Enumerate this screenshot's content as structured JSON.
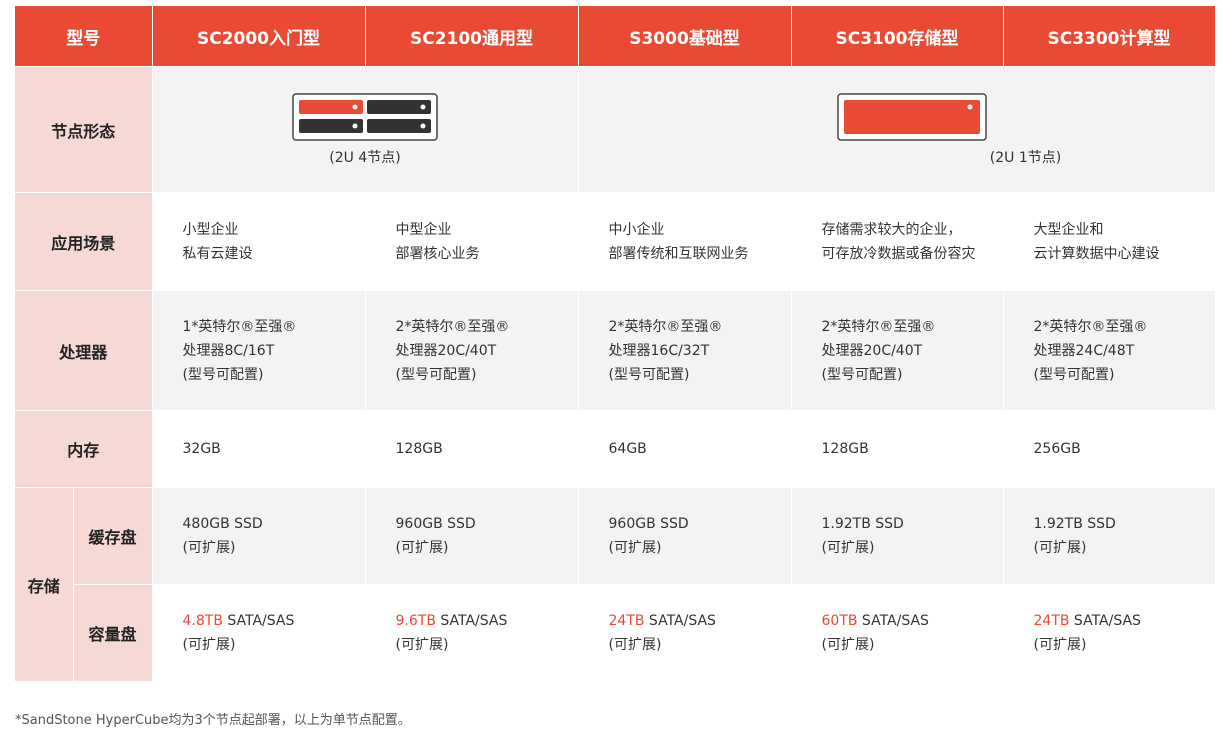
{
  "header": {
    "col0": "型号",
    "models": [
      "SC2000入门型",
      "SC2100通用型",
      "S3000基础型",
      "SC3100存储型",
      "SC3300计算型"
    ]
  },
  "rows": {
    "form": {
      "label": "节点形态",
      "left_caption": "(2U 4节点)",
      "right_caption": "(2U 1节点)",
      "left_icon": "server-2u-4node-icon",
      "right_icon": "server-2u-1node-icon"
    },
    "scenario": {
      "label": "应用场景",
      "values": [
        [
          "小型企业",
          "私有云建设"
        ],
        [
          "中型企业",
          "部署核心业务"
        ],
        [
          "中小企业",
          "部署传统和互联网业务"
        ],
        [
          "存储需求较大的企业，",
          "可存放冷数据或备份容灾"
        ],
        [
          "大型企业和",
          "云计算数据中心建设"
        ]
      ]
    },
    "cpu": {
      "label": "处理器",
      "values": [
        [
          "1*英特尔®至强®",
          "处理器8C/16T",
          "(型号可配置)"
        ],
        [
          "2*英特尔®至强®",
          "处理器20C/40T",
          "(型号可配置)"
        ],
        [
          "2*英特尔®至强®",
          "处理器16C/32T",
          "(型号可配置)"
        ],
        [
          "2*英特尔®至强®",
          "处理器20C/40T",
          "(型号可配置)"
        ],
        [
          "2*英特尔®至强®",
          "处理器24C/48T",
          "(型号可配置)"
        ]
      ]
    },
    "memory": {
      "label": "内存",
      "values": [
        "32GB",
        "128GB",
        "64GB",
        "128GB",
        "256GB"
      ]
    },
    "storage": {
      "label": "存储",
      "cache": {
        "label": "缓存盘",
        "values": [
          [
            "480GB SSD",
            "(可扩展)"
          ],
          [
            "960GB SSD",
            "(可扩展)"
          ],
          [
            "960GB SSD",
            "(可扩展)"
          ],
          [
            "1.92TB SSD",
            "(可扩展)"
          ],
          [
            "1.92TB SSD",
            "(可扩展)"
          ]
        ]
      },
      "capacity": {
        "label": "容量盘",
        "values": [
          {
            "size": "4.8TB",
            "type": " SATA/SAS",
            "note": "(可扩展)"
          },
          {
            "size": "9.6TB",
            "type": " SATA/SAS",
            "note": "(可扩展)"
          },
          {
            "size": "24TB",
            "type": " SATA/SAS",
            "note": "(可扩展)"
          },
          {
            "size": "60TB",
            "type": " SATA/SAS",
            "note": "(可扩展)"
          },
          {
            "size": "24TB",
            "type": " SATA/SAS",
            "note": "(可扩展)"
          }
        ]
      }
    }
  },
  "footnote": "*SandStone HyperCube均为3个节点起部署，以上为单节点配置。",
  "colors": {
    "accent": "#e84a33",
    "rowhead": "#f6d9d5",
    "zebra": "#f3f3f3"
  }
}
